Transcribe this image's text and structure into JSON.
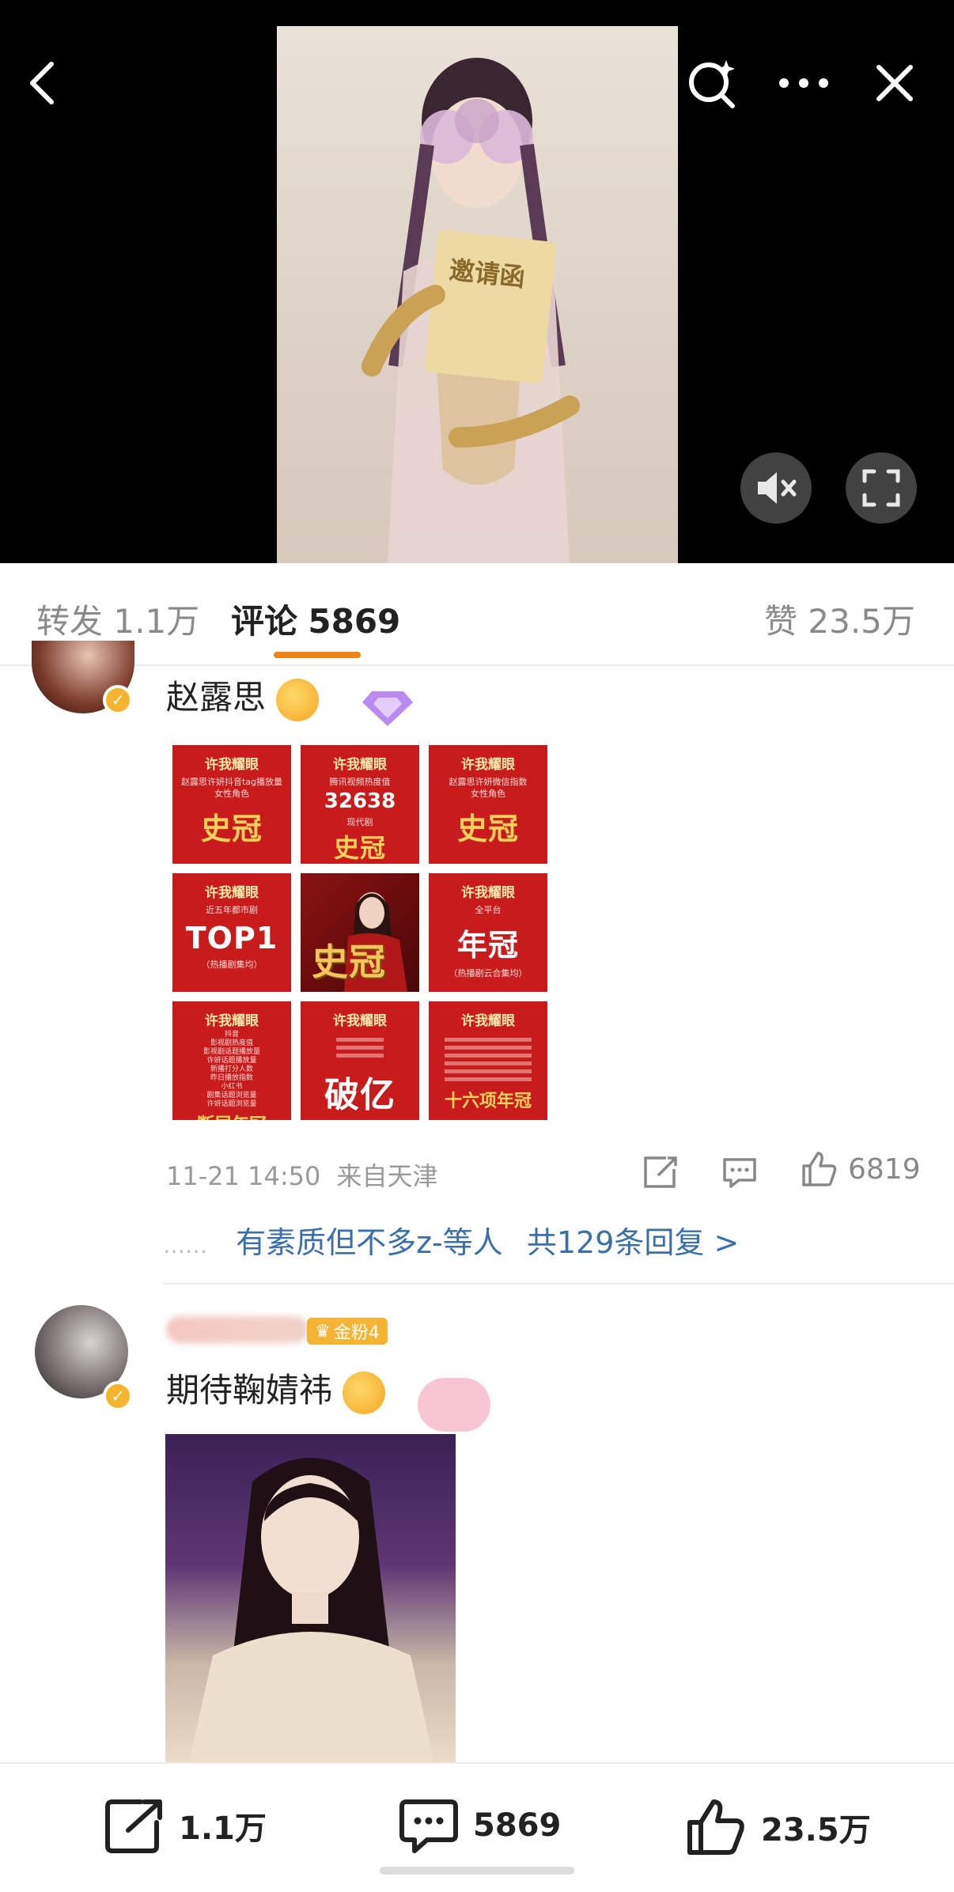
{
  "video": {
    "poster_text": "邀请函"
  },
  "tabs": {
    "repost_label": "转发",
    "repost_count": "1.1万",
    "comment_label": "评论",
    "comment_count": "5869",
    "like_label": "赞",
    "like_count": "23.5万"
  },
  "comment1": {
    "text": "赵露思",
    "image_cells": [
      {
        "head": "许我耀眼",
        "small": "赵露思许妍抖音tag播放量\n女性角色",
        "big": "史冠"
      },
      {
        "head": "许我耀眼",
        "small": "腾讯视频热度值",
        "num": "32638",
        "small2": "现代剧",
        "big": "史冠"
      },
      {
        "head": "许我耀眼",
        "small": "赵露思许妍微信指数\n女性角色",
        "big": "史冠"
      },
      {
        "head": "许我耀眼",
        "small": "近五年都市剧",
        "big": "TOP1",
        "small2": "（热播剧集均）"
      },
      {
        "center": "史冠"
      },
      {
        "head": "许我耀眼",
        "small": "全平台",
        "big": "年冠",
        "small2": "（热播剧云合集均）"
      },
      {
        "head": "许我耀眼",
        "small": "抖音\n影视剧热度值\n影视剧话题播放量\n许妍话题播放量\n新播打分人数\n昨日播放指数\n小红书\n剧集话题浏览量\n许妍话题浏览量",
        "mid": "断层年冠"
      },
      {
        "head": "许我耀眼",
        "big": "破亿"
      },
      {
        "head": "许我耀眼",
        "mid": "十六项年冠"
      }
    ],
    "timestamp": "11-21 14:50",
    "location": "来自天津",
    "like_count": "6819",
    "replies_user": "有素质但不多z-等人",
    "replies_count": "共129条回复 >",
    "replies_dots": "……"
  },
  "comment2": {
    "fan_badge": "金粉4",
    "text": "期待鞠婧祎"
  },
  "bottombar": {
    "repost_count": "1.1万",
    "comment_count": "5869",
    "like_count": "23.5万"
  }
}
